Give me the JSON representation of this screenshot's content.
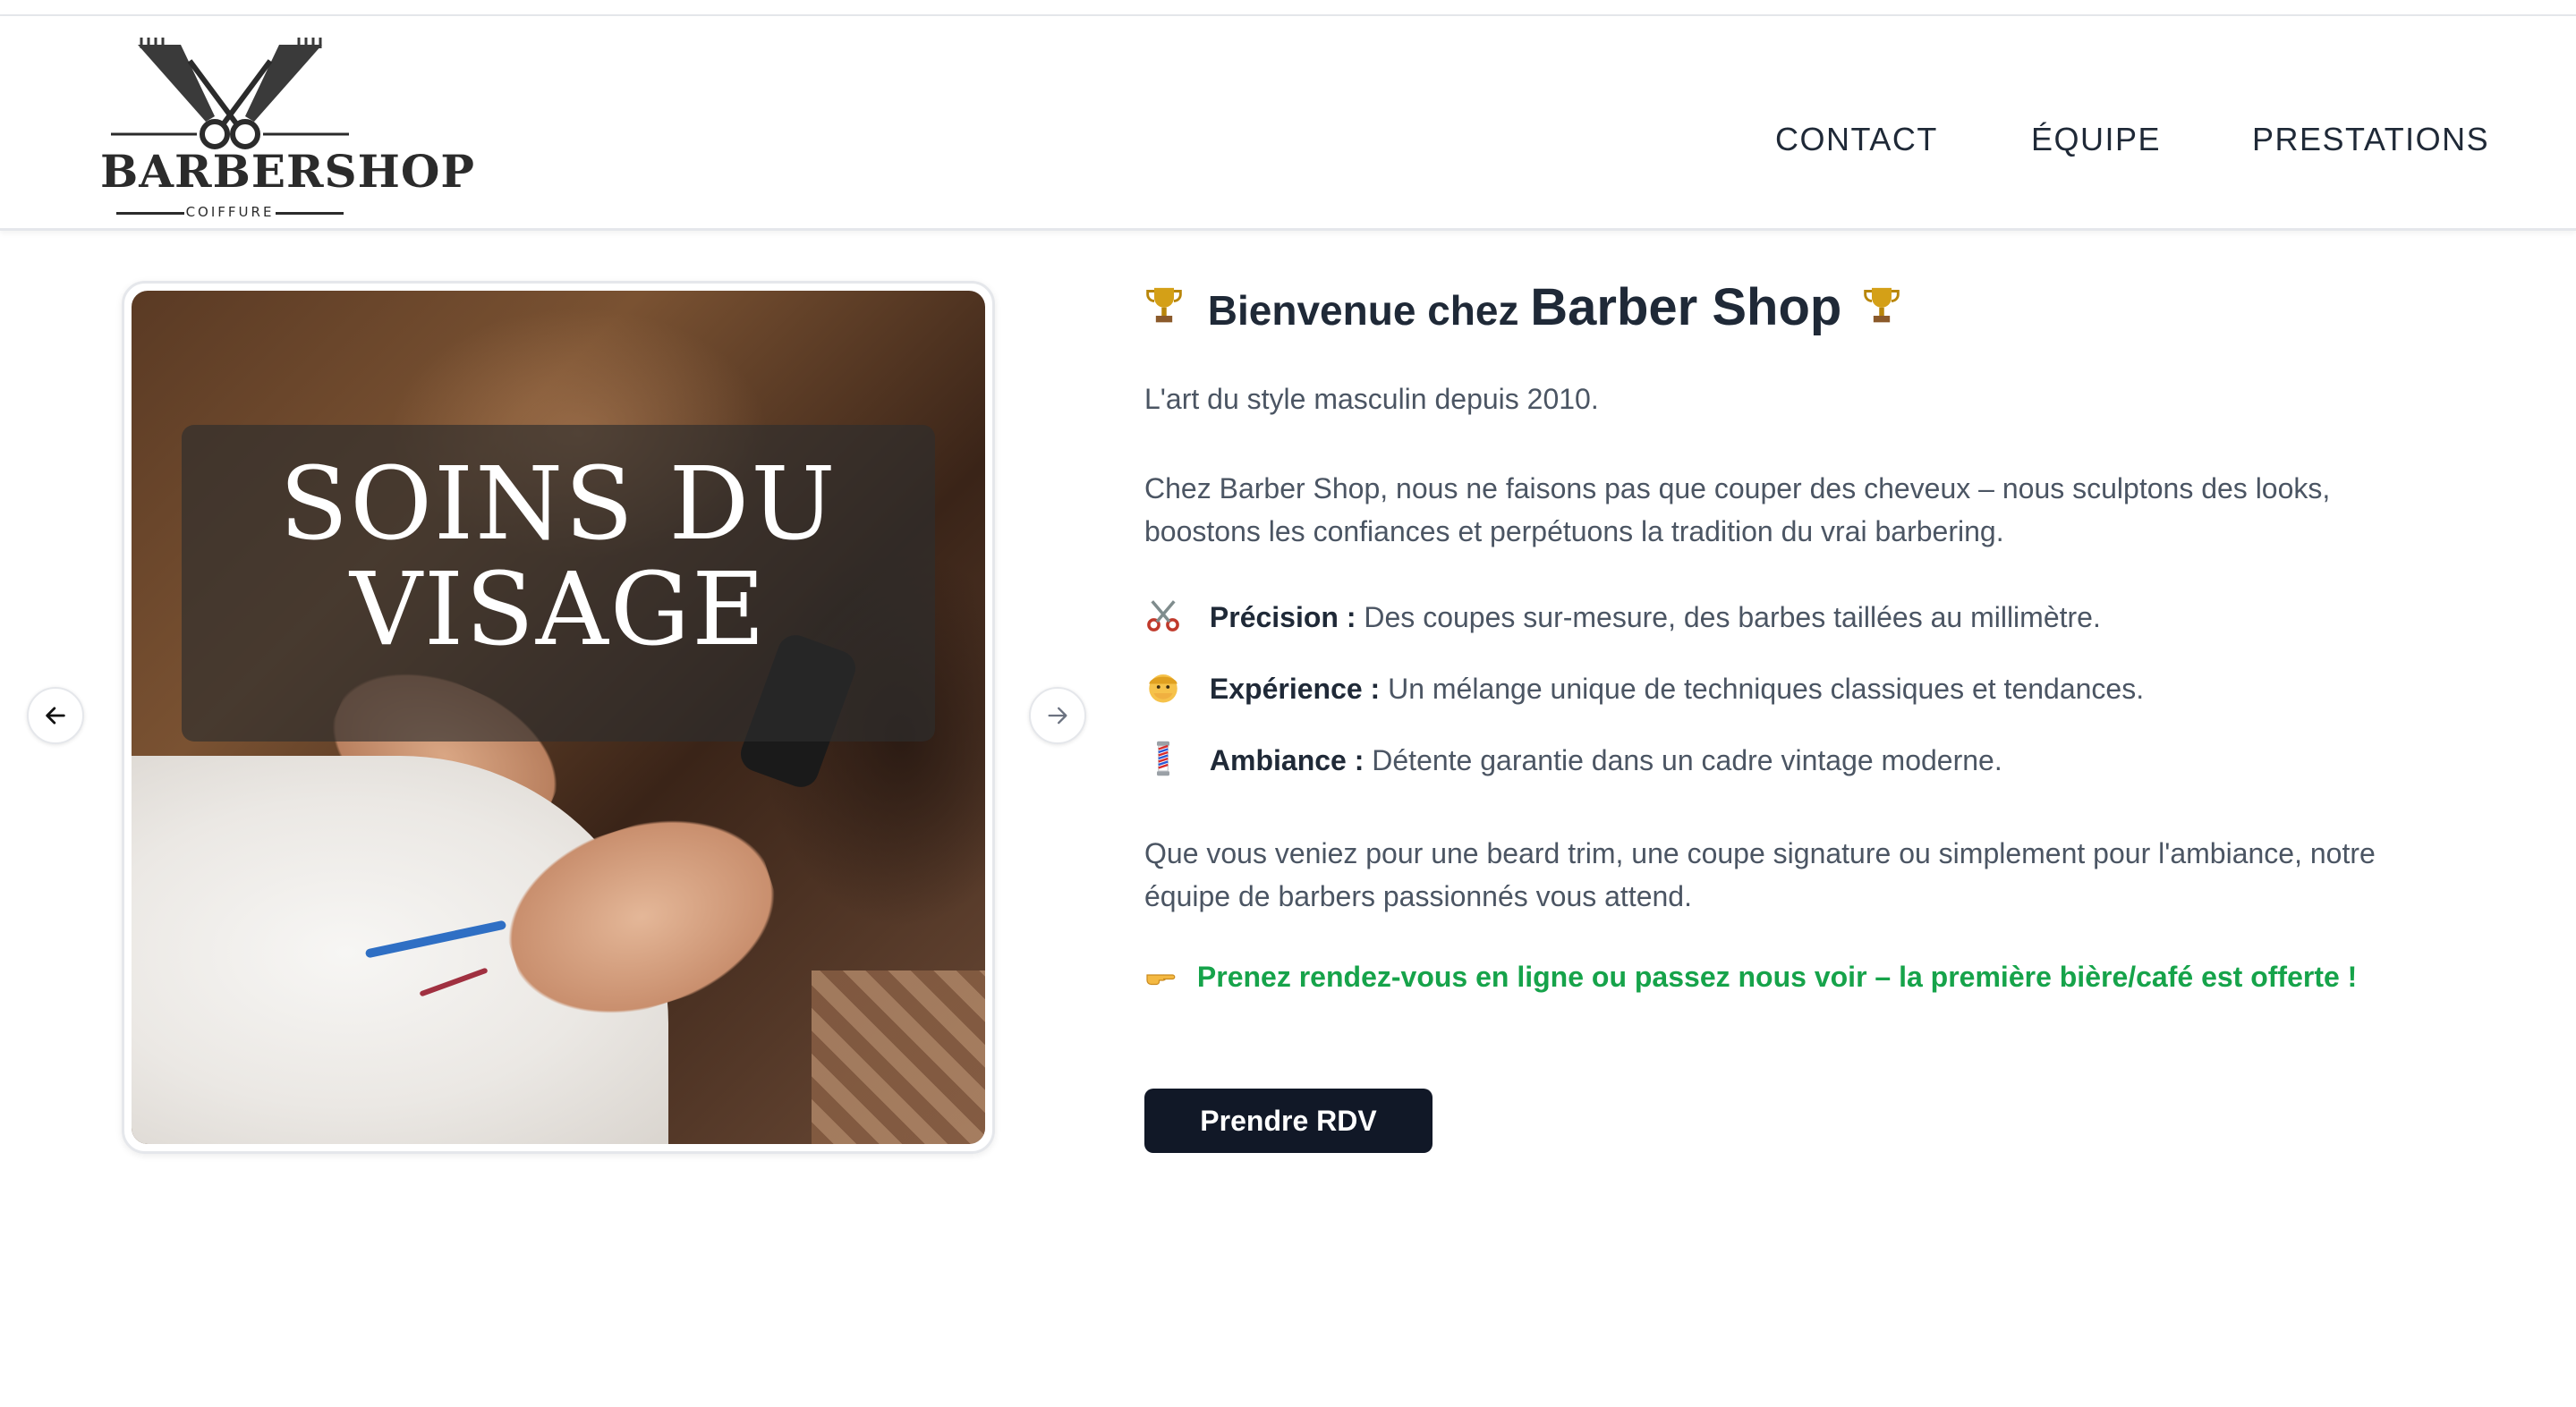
{
  "brand": {
    "name": "BARBERSHOP",
    "subtitle": "COIFFURE"
  },
  "nav": {
    "items": [
      {
        "label": "CONTACT"
      },
      {
        "label": "ÉQUIPE"
      },
      {
        "label": "PRESTATIONS"
      }
    ]
  },
  "carousel": {
    "slide_caption_line1": "SOINS DU",
    "slide_caption_line2": "VISAGE",
    "prev_icon": "arrow-left-icon",
    "next_icon": "arrow-right-icon"
  },
  "welcome": {
    "heading_prefix": "Bienvenue chez",
    "heading_brand": "Barber Shop",
    "tagline": "L'art du style masculin depuis 2010.",
    "intro": "Chez Barber Shop, nous ne faisons pas que couper des cheveux – nous sculptons des looks, boostons les confiances et perpétuons la tradition du vrai barbering.",
    "features": [
      {
        "icon": "scissors-icon",
        "title": "Précision :",
        "text": "Des coupes sur-mesure, des barbes taillées au millimètre."
      },
      {
        "icon": "man-face-icon",
        "title": "Expérience :",
        "text": "Un mélange unique de techniques classiques et tendances."
      },
      {
        "icon": "barber-pole-icon",
        "title": "Ambiance :",
        "text": "Détente garantie dans un cadre vintage moderne."
      }
    ],
    "outro": "Que vous veniez pour une beard trim, une coupe signature ou simplement pour l'ambiance, notre équipe de barbers passionnés vous attend.",
    "promo": "Prenez rendez-vous en ligne ou passez nous voir – la première bière/café est offerte !",
    "cta_label": "Prendre RDV"
  },
  "colors": {
    "primary_dark": "#111827",
    "promo_green": "#16a34a",
    "text_gray": "#4b5563"
  }
}
